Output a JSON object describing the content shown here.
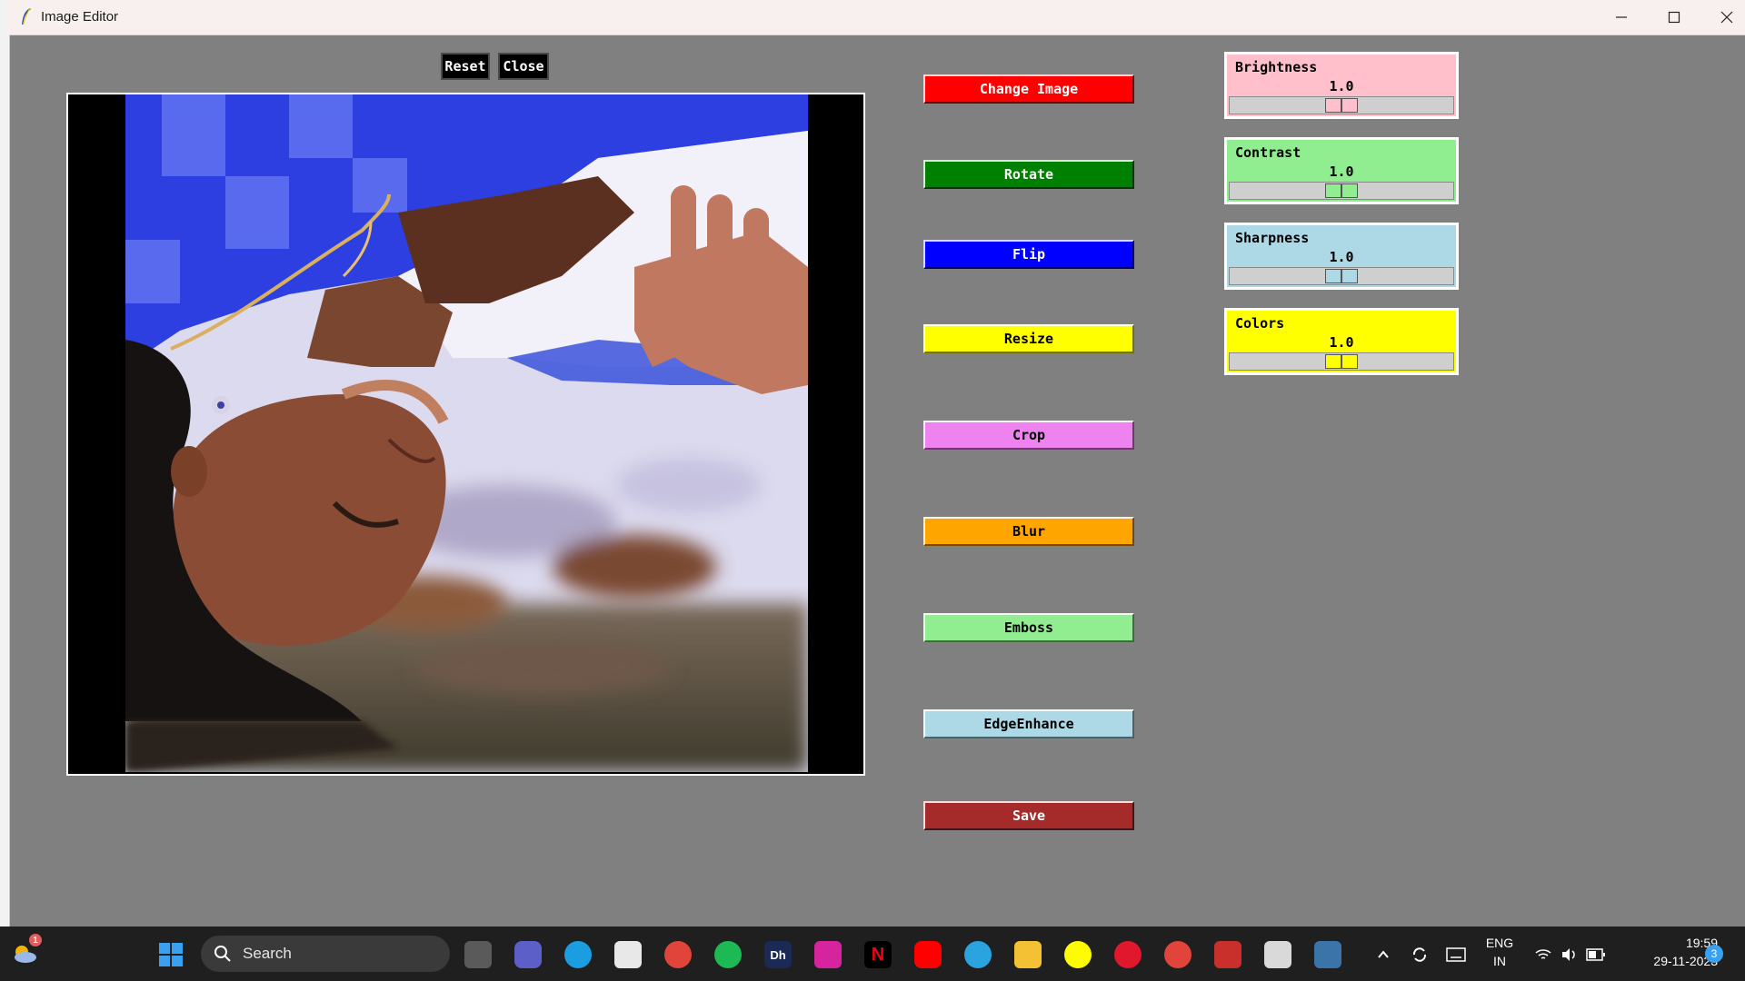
{
  "window": {
    "title": "Image Editor"
  },
  "top_buttons": {
    "reset": "Reset",
    "close": "Close"
  },
  "actions": [
    {
      "label": "Change Image",
      "color": "#ff0000"
    },
    {
      "label": "Rotate",
      "color": "#008000"
    },
    {
      "label": "Flip",
      "color": "#0000ff"
    },
    {
      "label": "Resize",
      "color": "#ffff00"
    },
    {
      "label": "Crop",
      "color": "#ee82ee"
    },
    {
      "label": "Blur",
      "color": "#ffa500"
    },
    {
      "label": "Emboss",
      "color": "#90ee90"
    },
    {
      "label": "EdgeEnhance",
      "color": "#add8e6"
    },
    {
      "label": "Save",
      "color": "#a52a2a"
    }
  ],
  "sliders": [
    {
      "label": "Brightness",
      "value": "1.0",
      "level": 0.5,
      "color": "#ffc0cb"
    },
    {
      "label": "Contrast",
      "value": "1.0",
      "level": 0.5,
      "color": "#90ee90"
    },
    {
      "label": "Sharpness",
      "value": "1.0",
      "level": 0.5,
      "color": "#add8e6"
    },
    {
      "label": "Colors",
      "value": "1.0",
      "level": 0.5,
      "color": "#ffff00"
    }
  ],
  "taskbar": {
    "search_placeholder": "Search",
    "weather_badge": "1",
    "language": "ENG",
    "region": "IN",
    "time": "19:59",
    "date": "29-11-2023",
    "notification_count": "3",
    "apps": [
      "start-icon",
      "task-view-icon",
      "meet-icon",
      "edge-icon",
      "store-icon",
      "chrome-icon",
      "spotify-icon",
      "dh-icon",
      "instagram-icon",
      "netflix-icon",
      "youtube-icon",
      "telegram-icon",
      "file-explorer-icon",
      "snapchat-icon",
      "opera-icon",
      "chrome-profile-icon",
      "wps-office-icon",
      "python-file-icon",
      "python-app-icon"
    ]
  }
}
